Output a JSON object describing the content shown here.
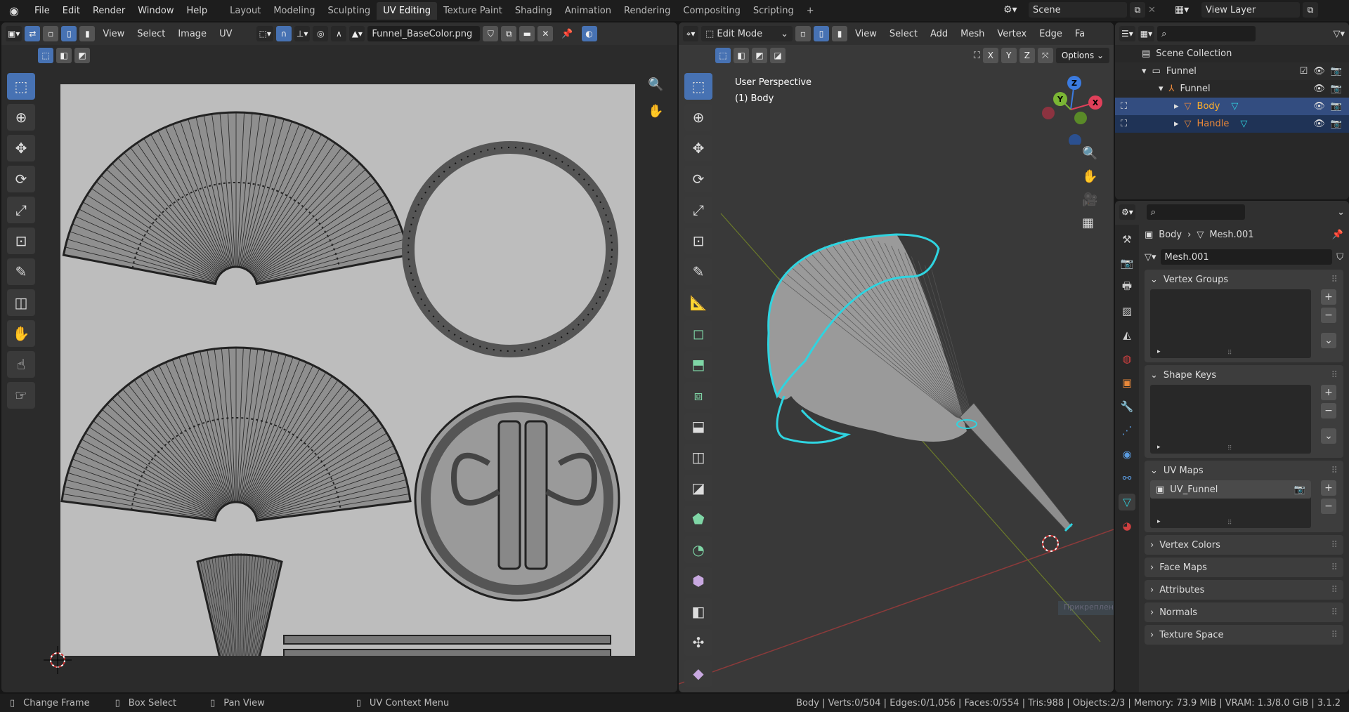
{
  "topbar": {
    "menus": [
      "File",
      "Edit",
      "Render",
      "Window",
      "Help"
    ],
    "workspaces": [
      "Layout",
      "Modeling",
      "Sculpting",
      "UV Editing",
      "Texture Paint",
      "Shading",
      "Animation",
      "Rendering",
      "Compositing",
      "Scripting"
    ],
    "active_workspace": "UV Editing",
    "add_workspace": "+",
    "scene": "Scene",
    "view_layer": "View Layer"
  },
  "uv_editor": {
    "menus": [
      "View",
      "Select",
      "Image",
      "UV"
    ],
    "image_name": "Funnel_BaseColor.png"
  },
  "viewport": {
    "mode": "Edit Mode",
    "menus": [
      "View",
      "Select",
      "Add",
      "Mesh",
      "Vertex",
      "Edge",
      "Fa"
    ],
    "axes": [
      "X",
      "Y",
      "Z"
    ],
    "options": "Options",
    "overlay_title": "User Perspective",
    "overlay_object": "(1) Body",
    "gizmo": {
      "z": "Z",
      "y": "Y",
      "x": "X"
    },
    "tooltip": "Прикрепленные"
  },
  "outliner": {
    "root": "Scene Collection",
    "collection": "Funnel",
    "items": [
      {
        "name": "Funnel"
      },
      {
        "name": "Body"
      },
      {
        "name": "Handle"
      }
    ]
  },
  "properties": {
    "breadcrumb_object": "Body",
    "breadcrumb_mesh": "Mesh.001",
    "mesh_name": "Mesh.001",
    "panels": {
      "vertex_groups": "Vertex Groups",
      "shape_keys": "Shape Keys",
      "uv_maps": "UV Maps",
      "vertex_colors": "Vertex Colors",
      "face_maps": "Face Maps",
      "attributes": "Attributes",
      "normals": "Normals",
      "texture_space": "Texture Space"
    },
    "uv_map_item": "UV_Funnel"
  },
  "statusbar": {
    "left": [
      {
        "label": "Change Frame"
      },
      {
        "label": "Box Select"
      },
      {
        "label": "Pan View"
      },
      {
        "label": "UV Context Menu"
      }
    ],
    "stats": "Body | Verts:0/504 | Edges:0/1,056 | Faces:0/554 | Tris:988 | Objects:2/3 | Memory: 73.9 MiB | VRAM: 1.3/8.0 GiB | 3.1.2"
  },
  "colors": {
    "accent": "#4772b3",
    "selected_edge": "#2fd4e0",
    "object_orange": "#e8883a"
  }
}
